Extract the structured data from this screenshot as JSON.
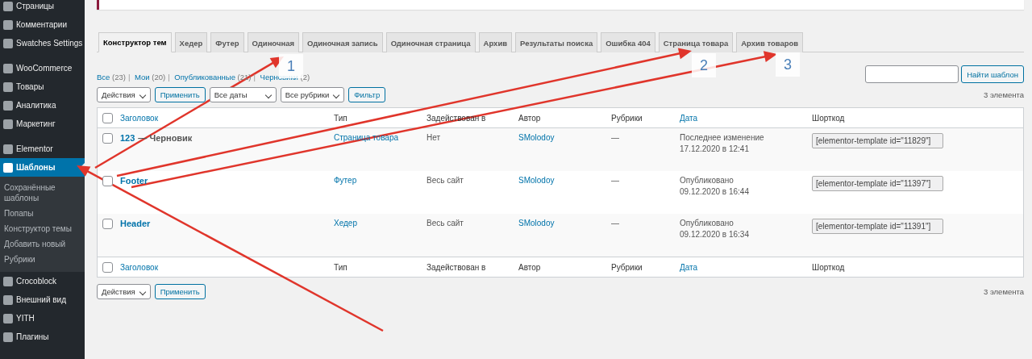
{
  "sidebar": {
    "groups": [
      {
        "items": [
          {
            "label": "Страницы",
            "selected": false
          },
          {
            "label": "Комментарии",
            "selected": false
          },
          {
            "label": "Swatches Settings",
            "selected": false
          }
        ]
      },
      {
        "items": [
          {
            "label": "WooCommerce",
            "selected": false
          },
          {
            "label": "Товары",
            "selected": false
          },
          {
            "label": "Аналитика",
            "selected": false
          },
          {
            "label": "Маркетинг",
            "selected": false
          }
        ]
      },
      {
        "items": [
          {
            "label": "Elementor",
            "selected": false
          },
          {
            "label": "Шаблоны",
            "selected": true,
            "children": [
              {
                "label": "Сохранённые шаблоны"
              },
              {
                "label": "Попапы"
              },
              {
                "label": "Конструктор темы"
              },
              {
                "label": "Добавить новый"
              },
              {
                "label": "Рубрики"
              }
            ]
          }
        ]
      },
      {
        "items": [
          {
            "label": "Crocoblock",
            "selected": false
          },
          {
            "label": "Внешний вид",
            "selected": false
          },
          {
            "label": "YITH",
            "selected": false
          },
          {
            "label": "Плагины",
            "selected": false
          }
        ]
      }
    ]
  },
  "tabs": [
    {
      "label": "Конструктор тем",
      "selected": true
    },
    {
      "label": "Хедер",
      "selected": false
    },
    {
      "label": "Футер",
      "selected": false
    },
    {
      "label": "Одиночная",
      "selected": false
    },
    {
      "label": "Одиночная запись",
      "selected": false
    },
    {
      "label": "Одиночная страница",
      "selected": false
    },
    {
      "label": "Архив",
      "selected": false
    },
    {
      "label": "Результаты поиска",
      "selected": false
    },
    {
      "label": "Ошибка 404",
      "selected": false
    },
    {
      "label": "Страница товара",
      "selected": false
    },
    {
      "label": "Архив товаров",
      "selected": false
    }
  ],
  "filters": [
    {
      "label": "Все",
      "count": "(23)"
    },
    {
      "separator": "|",
      "label": "Мои",
      "count": "(20)"
    },
    {
      "separator": "|",
      "label": "Опубликованные",
      "count": "(21)"
    },
    {
      "separator": "|",
      "label": "Черновики",
      "count": "(2)"
    }
  ],
  "search": {
    "button": "Найти шаблон"
  },
  "toolbar_top": {
    "bulk_action": "Действия",
    "apply": "Применить",
    "dates": "Все даты",
    "categories": "Все рубрики",
    "filter": "Фильтр",
    "count": "3 элемента"
  },
  "table": {
    "select_all_checked": false,
    "footer_select_all_checked": false,
    "footer_columns": [
      {
        "label": "Заголовок",
        "sortable": true
      },
      {
        "label": "Тип",
        "sortable": false
      },
      {
        "label": "Задействован в",
        "sortable": false
      },
      {
        "label": "Автор",
        "sortable": false
      },
      {
        "label": "Рубрики",
        "sortable": false
      },
      {
        "label": "Дата",
        "sortable": true
      },
      {
        "label": "Шорткод",
        "sortable": false
      }
    ],
    "columns": [
      {
        "label": "Заголовок",
        "sortable": true
      },
      {
        "label": "Тип",
        "sortable": false
      },
      {
        "label": "Задействован в",
        "sortable": false
      },
      {
        "label": "Автор",
        "sortable": false
      },
      {
        "label": "Рубрики",
        "sortable": false
      },
      {
        "label": "Дата",
        "sortable": true
      },
      {
        "label": "Шорткод",
        "sortable": false
      }
    ],
    "rows": [
      {
        "checked": false,
        "title": "123",
        "state": "— Черновик",
        "type": "Страница товара",
        "used_in": "Нет",
        "author": "SMolodoy",
        "categories": "—",
        "date_status": "Последнее изменение",
        "date": "17.12.2020 в 12:41",
        "shortcode": "[elementor-template id=\"11829\"]"
      },
      {
        "checked": false,
        "title": "Footer",
        "type": "Футер",
        "used_in": "Весь сайт",
        "author": "SMolodoy",
        "categories": "—",
        "date_status": "Опубликовано",
        "date": "09.12.2020 в 16:44",
        "shortcode": "[elementor-template id=\"11397\"]"
      },
      {
        "checked": false,
        "title": "Header",
        "type": "Хедер",
        "used_in": "Весь сайт",
        "author": "SMolodoy",
        "categories": "—",
        "date_status": "Опубликовано",
        "date": "09.12.2020 в 16:34",
        "shortcode": "[elementor-template id=\"11391\"]"
      }
    ]
  },
  "toolbar_bottom": {
    "bulk_action": "Действия",
    "apply": "Применить",
    "count": "3 элемента"
  },
  "annotations": [
    {
      "label": "1"
    },
    {
      "label": "2"
    },
    {
      "label": "3"
    }
  ]
}
